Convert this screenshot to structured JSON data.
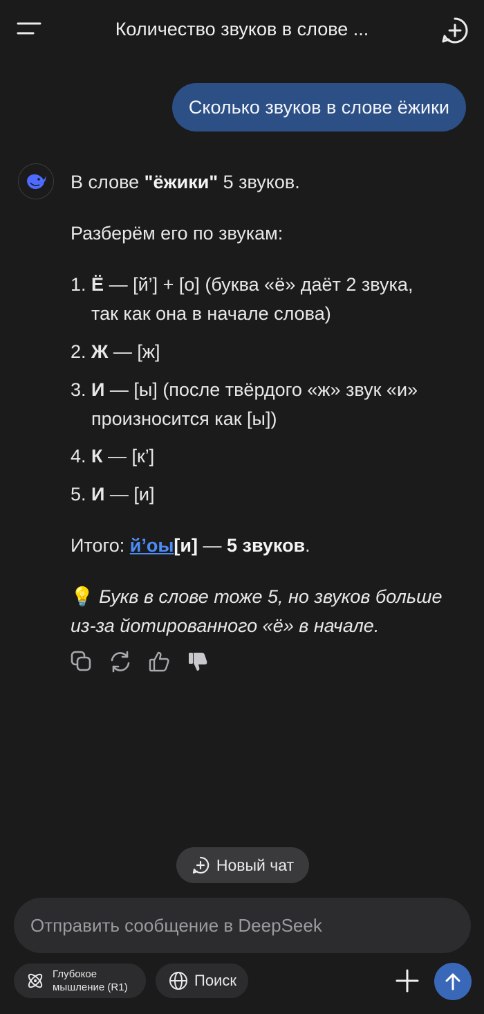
{
  "header": {
    "title": "Количество звуков в слове ...",
    "menu_icon": "hamburger-menu-icon",
    "new_chat_icon": "plus-circle-icon"
  },
  "user_message": "Сколько звуков в слове ёжики",
  "answer": {
    "line1_pre": "В слове ",
    "line1_word": "\"ёжики\"",
    "line1_post": " 5 звуков.",
    "intro": "Разберём его по звукам:",
    "items": [
      {
        "num": "1.",
        "letter": "Ё",
        "text_a": " — [й’] + [о] (буква «ё» даёт 2 звука,",
        "text_b": "так как она в начале слова)"
      },
      {
        "num": "2.",
        "letter": "Ж",
        "text_a": " — [ж]"
      },
      {
        "num": "3.",
        "letter": "И",
        "text_a": " — [ы] (после твёрдого «ж» звук «и»",
        "text_b": "произносится как [ы])"
      },
      {
        "num": "4.",
        "letter": "К",
        "text_a": " — [к’]"
      },
      {
        "num": "5.",
        "letter": "И",
        "text_a": " — [и]"
      }
    ],
    "total_label": "Итого: ",
    "total_link": "й’оы",
    "total_bold_part": "[и]",
    "total_dash": " — ",
    "total_bold": "5 звуков",
    "total_end": ".",
    "tip_emoji": "💡",
    "tip_line1": "Букв в слове тоже 5, но звуков больше",
    "tip_line2": "из-за йотированного «ё» в начале."
  },
  "actions": [
    "copy-icon",
    "regenerate-icon",
    "thumbs-up-icon",
    "thumbs-down-icon"
  ],
  "new_chat_button": "Новый чат",
  "input": {
    "placeholder": "Отправить сообщение в DeepSeek",
    "value": ""
  },
  "deep_thinking": {
    "line1": "Глубокое",
    "line2": "мышление (R1)"
  },
  "search_label": "Поиск",
  "colors": {
    "background": "#1b1b1c",
    "user_bubble": "#2c4f86",
    "accent_blue": "#4d8cf5",
    "send_button": "#3a68b8",
    "pill": "#2c2c2e"
  }
}
